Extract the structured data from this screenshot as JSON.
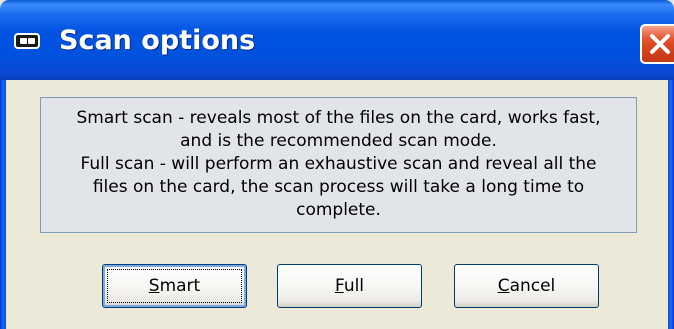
{
  "window": {
    "title": "Scan options",
    "title_icon": "card-reader-icon",
    "close_icon": "close-icon"
  },
  "message": {
    "lines": [
      "Smart scan - reveals most of the files on the card, works fast,",
      "and is the recommended scan mode.",
      "Full scan - will perform an exhaustive scan and reveal all the",
      "files on the card, the scan process will take a long time to",
      "complete."
    ]
  },
  "buttons": {
    "smart": {
      "first": "S",
      "rest": "mart"
    },
    "full": {
      "first": "F",
      "rest": "ull"
    },
    "cancel": {
      "first": "C",
      "rest": "ancel"
    }
  },
  "colors": {
    "titlebar": "#0053e1",
    "window_bg": "#ece9d8",
    "message_bg": "#e1e4e9",
    "close_button": "#d2401c"
  }
}
